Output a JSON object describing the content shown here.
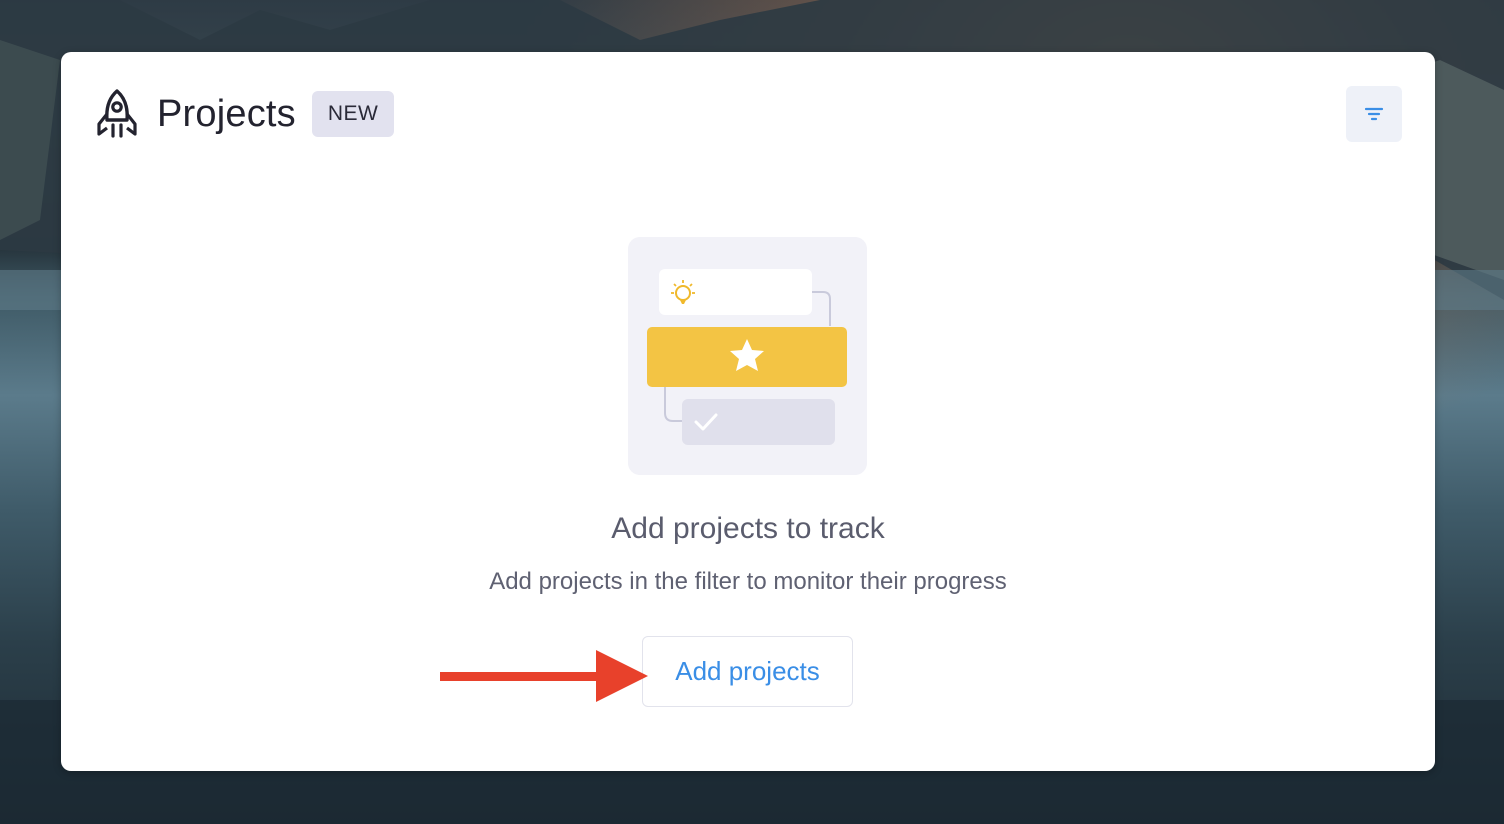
{
  "header": {
    "title": "Projects",
    "badge": "NEW",
    "title_icon": "rocket-icon",
    "filter_icon": "filter-icon"
  },
  "empty_state": {
    "title": "Add projects to track",
    "description": "Add projects in the filter to monitor their progress",
    "button_label": "Add projects",
    "illustration_icons": [
      "lightbulb-icon",
      "star-icon",
      "check-icon"
    ]
  },
  "annotation": {
    "type": "arrow-icon",
    "color": "#e8412b"
  },
  "colors": {
    "accent": "#3a8ee6",
    "highlight_yellow": "#f3c444",
    "badge_bg": "#e2e2ef"
  }
}
